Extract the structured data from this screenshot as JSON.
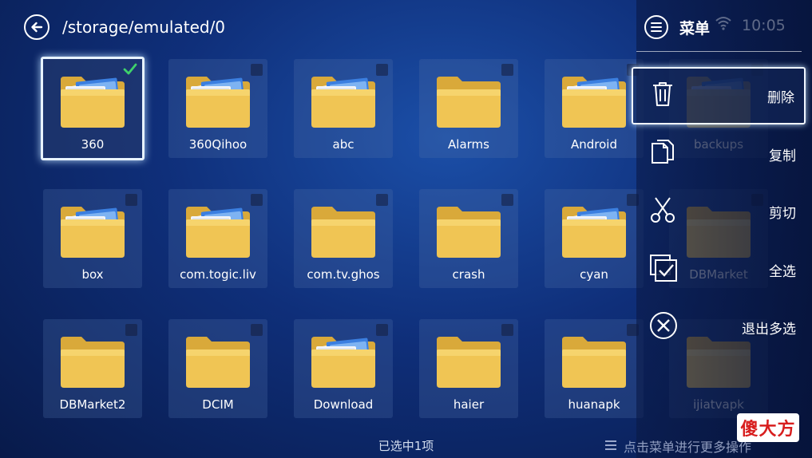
{
  "header": {
    "path": "/storage/emulated/0",
    "back_icon": "back-arrow-icon"
  },
  "files": [
    {
      "name": "360",
      "icon": "folder-with-papers-icon",
      "selected": true
    },
    {
      "name": "360Qihoo",
      "icon": "folder-with-papers-icon",
      "selected": false
    },
    {
      "name": "abc",
      "icon": "folder-with-papers-icon",
      "selected": false
    },
    {
      "name": "Alarms",
      "icon": "folder-icon",
      "selected": false
    },
    {
      "name": "Android",
      "icon": "folder-with-papers-icon",
      "selected": false
    },
    {
      "name": "backups",
      "icon": "folder-with-papers-icon",
      "selected": false
    },
    {
      "name": "box",
      "icon": "folder-with-papers-icon",
      "selected": false
    },
    {
      "name": "com.togic.liv",
      "icon": "folder-with-papers-icon",
      "selected": false
    },
    {
      "name": "com.tv.ghos",
      "icon": "folder-icon",
      "selected": false
    },
    {
      "name": "crash",
      "icon": "folder-icon",
      "selected": false
    },
    {
      "name": "cyan",
      "icon": "folder-with-papers-icon",
      "selected": false
    },
    {
      "name": "DBMarket",
      "icon": "folder-icon",
      "selected": false
    },
    {
      "name": "DBMarket2",
      "icon": "folder-icon",
      "selected": false
    },
    {
      "name": "DCIM",
      "icon": "folder-icon",
      "selected": false
    },
    {
      "name": "Download",
      "icon": "folder-with-papers-icon",
      "selected": false
    },
    {
      "name": "haier",
      "icon": "folder-icon",
      "selected": false
    },
    {
      "name": "huanapk",
      "icon": "folder-icon",
      "selected": false
    },
    {
      "name": "ijiatvapk",
      "icon": "folder-icon",
      "selected": false
    }
  ],
  "menu": {
    "title": "菜单",
    "time": "10:05",
    "items": [
      {
        "label": "删除",
        "icon": "trash-icon",
        "focused": true
      },
      {
        "label": "复制",
        "icon": "copy-icon",
        "focused": false
      },
      {
        "label": "剪切",
        "icon": "scissors-icon",
        "focused": false
      },
      {
        "label": "全选",
        "icon": "select-all-icon",
        "focused": false
      },
      {
        "label": "退出多选",
        "icon": "close-circle-icon",
        "focused": false
      }
    ]
  },
  "footer": {
    "selection_status": "已选中1项",
    "hint": "点击菜单进行更多操作"
  },
  "watermark": "傻大方",
  "colors": {
    "background": "#0f2f7a",
    "folder": "#f0c554",
    "check": "#3fd26a",
    "watermark_text": "#d81e1e"
  }
}
